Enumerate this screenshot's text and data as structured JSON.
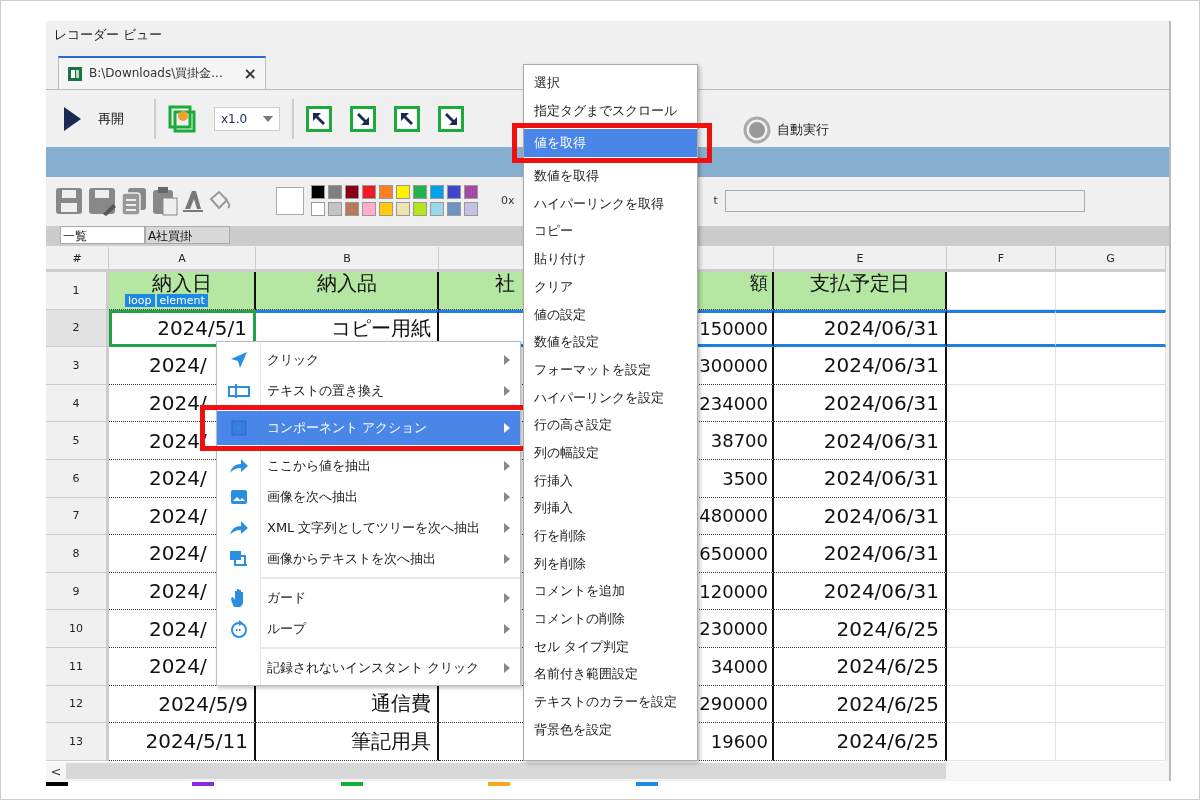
{
  "window": {
    "title": "レコーダー ビュー"
  },
  "tabs": [
    {
      "label": "B:\\Downloads\\買掛金...",
      "close": "×",
      "selected": true
    }
  ],
  "toolbar": {
    "resume": "再開",
    "zoom": "x1.0",
    "auto_run": {
      "label": "自動実行",
      "disabled": true
    }
  },
  "format_bar": {
    "palette": [
      {
        "color": "#000000"
      },
      {
        "color": "#7f7f7f"
      },
      {
        "color": "#880015"
      },
      {
        "color": "#ed1c24"
      },
      {
        "color": "#ff7f27"
      },
      {
        "color": "#fff200"
      },
      {
        "color": "#22b14c"
      },
      {
        "color": "#00a2e8"
      },
      {
        "color": "#3f48cc"
      },
      {
        "color": "#a349a4"
      },
      {
        "color": "#ffffff"
      },
      {
        "color": "#c3c3c3"
      },
      {
        "color": "#b97a57"
      },
      {
        "color": "#ffaec9"
      },
      {
        "color": "#ffc90e"
      },
      {
        "color": "#efe4b0"
      },
      {
        "color": "#b5e61d"
      },
      {
        "color": "#99d9ea"
      },
      {
        "color": "#7092be"
      },
      {
        "color": "#c8bfe7"
      }
    ],
    "code_label": "0x",
    "fragment": "t"
  },
  "sheet_tabs": [
    {
      "label": "一覧",
      "selected": true
    },
    {
      "label": "A社買掛",
      "selected": false
    }
  ],
  "grid": {
    "corner": "#",
    "columns": [
      "A",
      "B",
      null,
      null,
      "E",
      "F",
      "G"
    ],
    "rows": [
      {
        "num": "1",
        "kind": "heading",
        "selected": false,
        "cells": [
          "納入日",
          "納入品",
          "社",
          "額",
          "支払予定日",
          null,
          null
        ]
      },
      {
        "num": "2",
        "kind": "data",
        "selected": true,
        "cells": [
          "2024/5/1",
          "コピー用紙",
          null,
          "150000",
          "2024/06/31",
          null,
          null
        ]
      },
      {
        "num": "3",
        "kind": "data",
        "selected": false,
        "cells": [
          "2024/",
          null,
          null,
          "300000",
          "2024/06/31",
          null,
          null
        ]
      },
      {
        "num": "4",
        "kind": "data",
        "selected": false,
        "cells": [
          "2024/",
          null,
          null,
          "234000",
          "2024/06/31",
          null,
          null
        ]
      },
      {
        "num": "5",
        "kind": "data",
        "selected": false,
        "cells": [
          "2024/",
          null,
          null,
          "38700",
          "2024/06/31",
          null,
          null
        ]
      },
      {
        "num": "6",
        "kind": "data",
        "selected": false,
        "cells": [
          "2024/",
          null,
          null,
          "3500",
          "2024/06/31",
          null,
          null
        ]
      },
      {
        "num": "7",
        "kind": "data",
        "selected": false,
        "cells": [
          "2024/",
          null,
          null,
          "480000",
          "2024/06/31",
          null,
          null
        ]
      },
      {
        "num": "8",
        "kind": "data",
        "selected": false,
        "cells": [
          "2024/",
          null,
          null,
          "650000",
          "2024/06/31",
          null,
          null
        ]
      },
      {
        "num": "9",
        "kind": "data",
        "selected": false,
        "cells": [
          "2024/",
          null,
          null,
          "120000",
          "2024/06/31",
          null,
          null
        ]
      },
      {
        "num": "10",
        "kind": "data",
        "selected": false,
        "cells": [
          "2024/",
          null,
          null,
          "230000",
          "2024/6/25",
          null,
          null
        ]
      },
      {
        "num": "11",
        "kind": "data",
        "selected": false,
        "cells": [
          "2024/",
          null,
          null,
          "34000",
          "2024/6/25",
          null,
          null
        ]
      },
      {
        "num": "12",
        "kind": "data",
        "selected": false,
        "cells": [
          "2024/5/9",
          "通信費",
          null,
          "290000",
          "2024/6/25",
          null,
          null
        ]
      },
      {
        "num": "13",
        "kind": "data",
        "selected": false,
        "cells": [
          "2024/5/11",
          "筆記用具",
          null,
          "19600",
          "2024/6/25",
          null,
          null
        ]
      }
    ],
    "badges": [
      "loop",
      "element"
    ]
  },
  "context_menu": {
    "items": [
      {
        "kind": "item",
        "label": "クリック",
        "selected": false
      },
      {
        "kind": "item",
        "label": "テキストの置き換え",
        "selected": false
      },
      {
        "kind": "item",
        "label": "コンポーネント アクション",
        "selected": true
      },
      {
        "kind": "item",
        "label": "ここから値を抽出",
        "selected": false
      },
      {
        "kind": "item",
        "label": "画像を次へ抽出",
        "selected": false
      },
      {
        "kind": "item",
        "label": "XML 文字列としてツリーを次へ抽出",
        "selected": false
      },
      {
        "kind": "item",
        "label": "画像からテキストを次へ抽出",
        "selected": false
      },
      {
        "kind": "separator"
      },
      {
        "kind": "item",
        "label": "ガード",
        "selected": false
      },
      {
        "kind": "item",
        "label": "ループ",
        "selected": false
      },
      {
        "kind": "separator"
      },
      {
        "kind": "item",
        "label": "記録されないインスタント クリック",
        "selected": false
      }
    ]
  },
  "submenu": {
    "items": [
      {
        "label": "選択",
        "selected": false
      },
      {
        "label": "指定タグまでスクロール",
        "selected": false
      },
      {
        "label": "値を取得",
        "selected": true
      },
      {
        "label": "数値を取得",
        "selected": false
      },
      {
        "label": "ハイパーリンクを取得",
        "selected": false
      },
      {
        "label": "コピー",
        "selected": false
      },
      {
        "label": "貼り付け",
        "selected": false
      },
      {
        "label": "クリア",
        "selected": false
      },
      {
        "label": "値の設定",
        "selected": false
      },
      {
        "label": "数値を設定",
        "selected": false
      },
      {
        "label": "フォーマットを設定",
        "selected": false
      },
      {
        "label": "ハイパーリンクを設定",
        "selected": false
      },
      {
        "label": "行の高さ設定",
        "selected": false
      },
      {
        "label": "列の幅設定",
        "selected": false
      },
      {
        "label": "行挿入",
        "selected": false
      },
      {
        "label": "列挿入",
        "selected": false
      },
      {
        "label": "行を削除",
        "selected": false
      },
      {
        "label": "列を削除",
        "selected": false
      },
      {
        "label": "コメントを追加",
        "selected": false
      },
      {
        "label": "コメントの削除",
        "selected": false
      },
      {
        "label": "セル タイプ判定",
        "selected": false
      },
      {
        "label": "名前付き範囲設定",
        "selected": false
      },
      {
        "label": "テキストのカラーを設定",
        "selected": false
      },
      {
        "label": "背景色を設定",
        "selected": false
      }
    ]
  },
  "scrollbar": {
    "left_arrow": "<"
  },
  "bottom_markers": [
    {
      "color": "#000000"
    },
    {
      "color": "#8a2be2"
    },
    {
      "color": "#1aab3a"
    },
    {
      "color": "#f5a623"
    },
    {
      "color": "#1e88e5"
    }
  ]
}
